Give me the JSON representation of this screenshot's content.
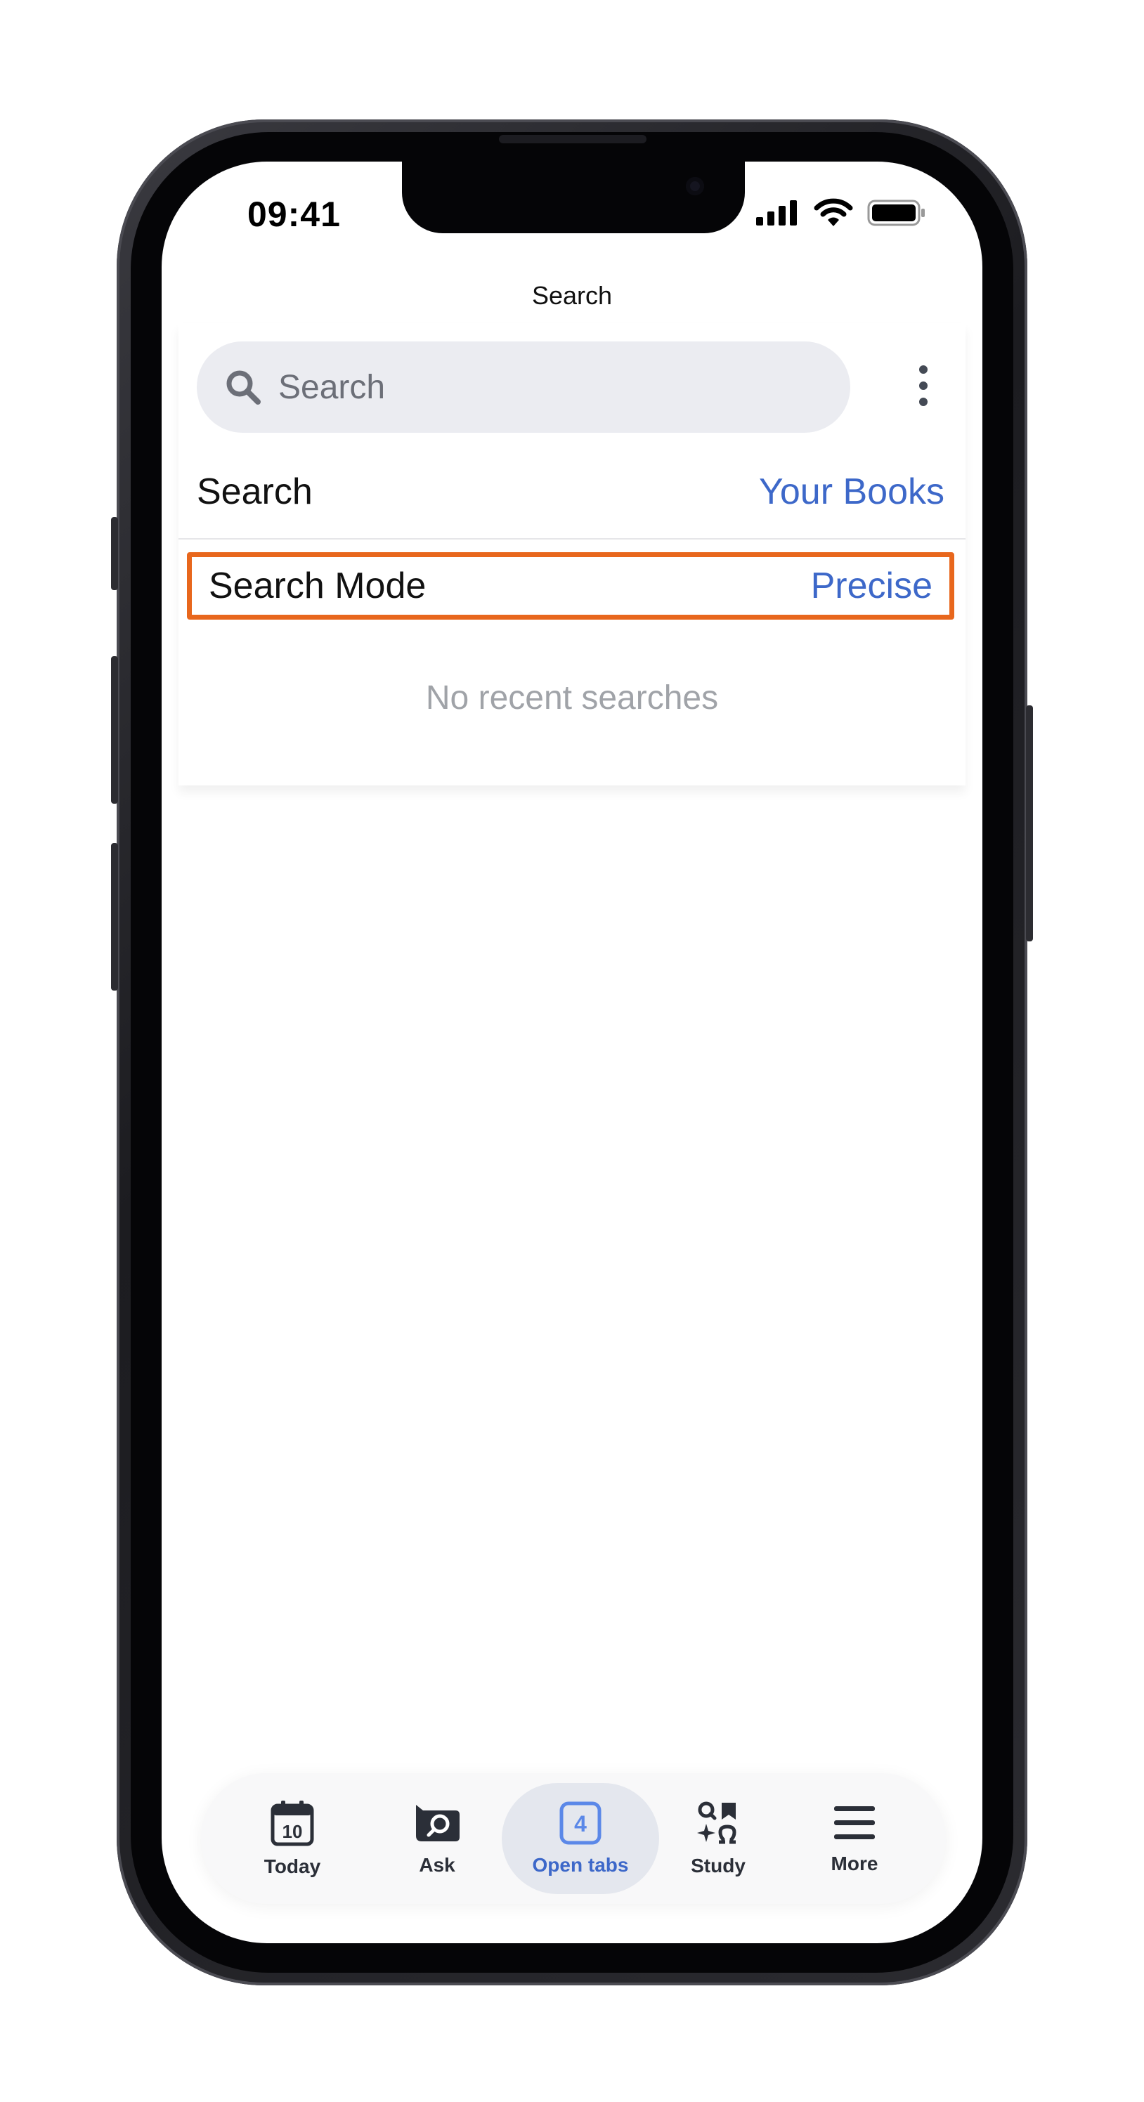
{
  "status_bar": {
    "time": "09:41",
    "icons": [
      "cellular-signal-icon",
      "wifi-icon",
      "battery-icon"
    ]
  },
  "nav": {
    "title": "Search"
  },
  "search": {
    "placeholder": "Search",
    "menu_icon": "more-vertical-icon"
  },
  "settings": {
    "scope_label": "Search",
    "scope_value": "Your Books",
    "mode_label": "Search Mode",
    "mode_value": "Precise"
  },
  "empty_state": {
    "message": "No recent searches"
  },
  "tabbar": {
    "tabs": [
      {
        "label": "Today",
        "icon": "calendar-icon",
        "badge": "10",
        "active": false
      },
      {
        "label": "Ask",
        "icon": "chat-search-icon",
        "active": false
      },
      {
        "label": "Open tabs",
        "icon": "tabs-icon",
        "badge": "4",
        "active": true
      },
      {
        "label": "Study",
        "icon": "study-icon",
        "active": false
      },
      {
        "label": "More",
        "icon": "menu-icon",
        "active": false
      }
    ]
  },
  "colors": {
    "accent": "#3d68c9",
    "highlight_border": "#e8671d",
    "search_bg": "#ebecf1",
    "muted_text": "#a0a3a8"
  }
}
